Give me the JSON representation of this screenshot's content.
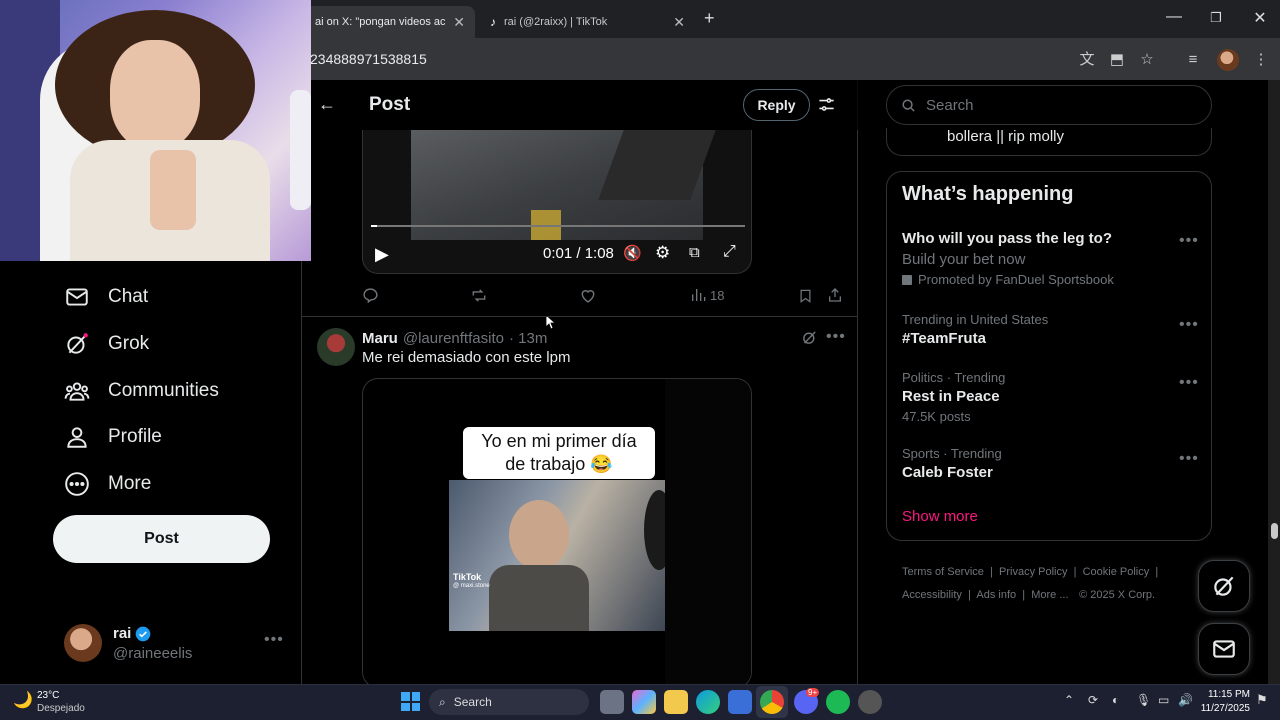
{
  "browser": {
    "tabs": [
      {
        "title": "ai on X: \"pongan videos acá para un",
        "active": true
      },
      {
        "title": "rai (@2raixx) | TikTok",
        "active": false
      }
    ],
    "url": "234888971538815",
    "new_tab": "+"
  },
  "nav": {
    "items": [
      {
        "label": "Chat",
        "icon": "mail-icon"
      },
      {
        "label": "Grok",
        "icon": "grok-icon"
      },
      {
        "label": "Communities",
        "icon": "communities-icon"
      },
      {
        "label": "Profile",
        "icon": "profile-icon"
      },
      {
        "label": "More",
        "icon": "more-circle-icon"
      }
    ],
    "post_button": "Post",
    "account": {
      "name": "rai",
      "handle": "@raineeelis",
      "verified": true
    }
  },
  "header": {
    "title": "Post",
    "reply_button": "Reply"
  },
  "video1": {
    "time": "0:01 / 1:08",
    "progress": 0.015
  },
  "actions1": {
    "views": "18"
  },
  "tweet2": {
    "name": "Maru",
    "handle": "@laurenftfasito",
    "time": "· 13m",
    "text": "Me rei demasiado con este lpm",
    "caption": "Yo en mi primer día de trabajo 😂",
    "watermark": "TikTok",
    "watermark_handle": "@ maxi.stone"
  },
  "search": {
    "placeholder": "Search"
  },
  "prev_card_text": "bollera || rip molly",
  "trends": {
    "title": "What’s happening",
    "items": [
      {
        "title": "Who will you pass the leg to?",
        "sub": "Build your bet now",
        "meta": "Promoted by FanDuel Sportsbook"
      },
      {
        "meta": "Trending in United States",
        "title": "#TeamFruta"
      },
      {
        "meta": "Politics · Trending",
        "title": "Rest in Peace",
        "sub": "47.5K posts"
      },
      {
        "meta": "Sports · Trending",
        "title": "Caleb Foster"
      }
    ],
    "show_more": "Show more"
  },
  "footer": [
    "Terms of Service",
    "Privacy Policy",
    "Cookie Policy",
    "Accessibility",
    "Ads info",
    "More ...",
    "© 2025 X Corp."
  ],
  "taskbar": {
    "weather_temp": "23°C",
    "weather_desc": "Despejado",
    "search_label": "Search",
    "time": "11:15 PM",
    "date": "11/27/2025",
    "discord_badge": "9+"
  },
  "colors": {
    "accent": "#1d9bf0",
    "show_more": "#f91880",
    "background": "#000000"
  }
}
